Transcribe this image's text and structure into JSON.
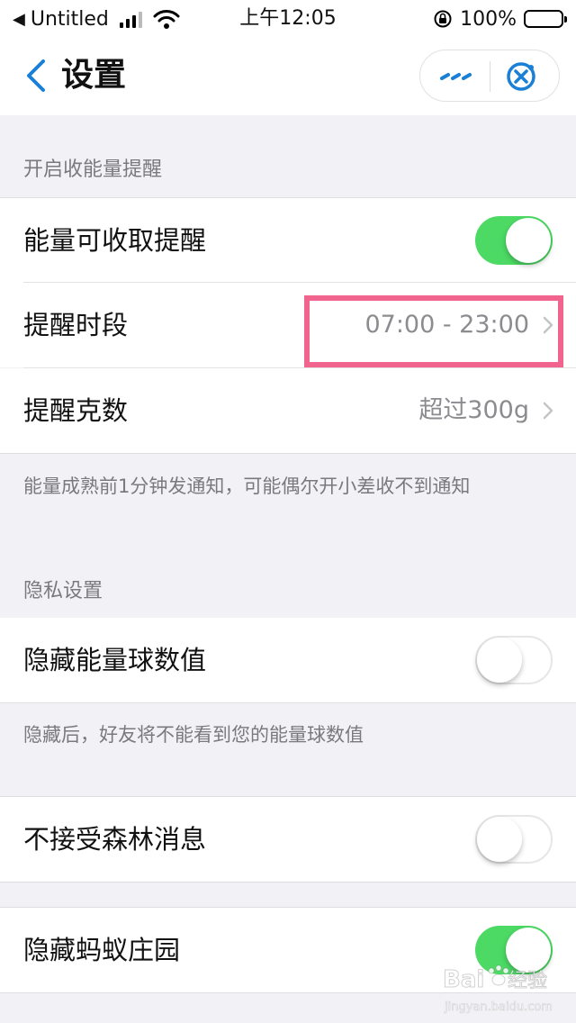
{
  "status_bar": {
    "back_app": "Untitled",
    "time": "上午12:05",
    "battery": "100%"
  },
  "nav": {
    "title": "设置"
  },
  "sections": {
    "energy_reminder": {
      "header": "开启收能量提醒",
      "rows": [
        {
          "label": "能量可收取提醒",
          "toggle": "on"
        },
        {
          "label": "提醒时段",
          "value": "07:00 - 23:00"
        },
        {
          "label": "提醒克数",
          "value": "超过300g"
        }
      ],
      "note": "能量成熟前1分钟发通知，可能偶尔开小差收不到通知"
    },
    "privacy": {
      "header": "隐私设置",
      "rows": [
        {
          "label": "隐藏能量球数值",
          "toggle": "off"
        }
      ],
      "note": "隐藏后，好友将不能看到您的能量球数值"
    },
    "forest_messages": {
      "rows": [
        {
          "label": "不接受森林消息",
          "toggle": "off"
        }
      ]
    },
    "farm": {
      "rows": [
        {
          "label": "隐藏蚂蚁庄园",
          "toggle": "on"
        }
      ]
    }
  },
  "watermark": {
    "brand": "Bai",
    "brand_cn": "经验",
    "site": "jingyan.baidu.com"
  },
  "colors": {
    "accent_blue": "#1a7fd6",
    "toggle_on": "#4cd964",
    "highlight": "#f0648e",
    "background": "#f2f2f6"
  }
}
